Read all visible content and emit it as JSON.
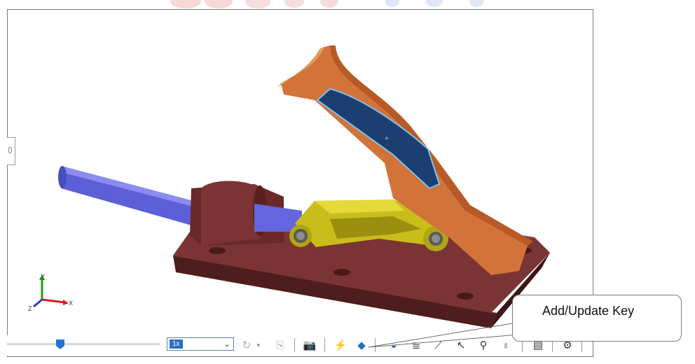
{
  "viewport": {
    "model_name": "toggle-clamp-assembly",
    "colors": {
      "plunger": "#5c5fd6",
      "base": "#6b2a2a",
      "link": "#c8bd1a",
      "handle": "#d2733a",
      "grip": "#1c3e70"
    }
  },
  "triad": {
    "x_label": "X",
    "y_label": "Y",
    "z_label": "Z"
  },
  "toolbar": {
    "speed_value": "1x",
    "icons": [
      "loop-icon",
      "copy-icon",
      "camera-icon",
      "calculate-icon",
      "add-key-icon",
      "motor-icon",
      "spring-icon",
      "damper-icon",
      "force-icon",
      "contact-icon",
      "gravity-icon",
      "results-icon",
      "settings-icon"
    ]
  },
  "callout": {
    "text": "Add/Update Key"
  }
}
